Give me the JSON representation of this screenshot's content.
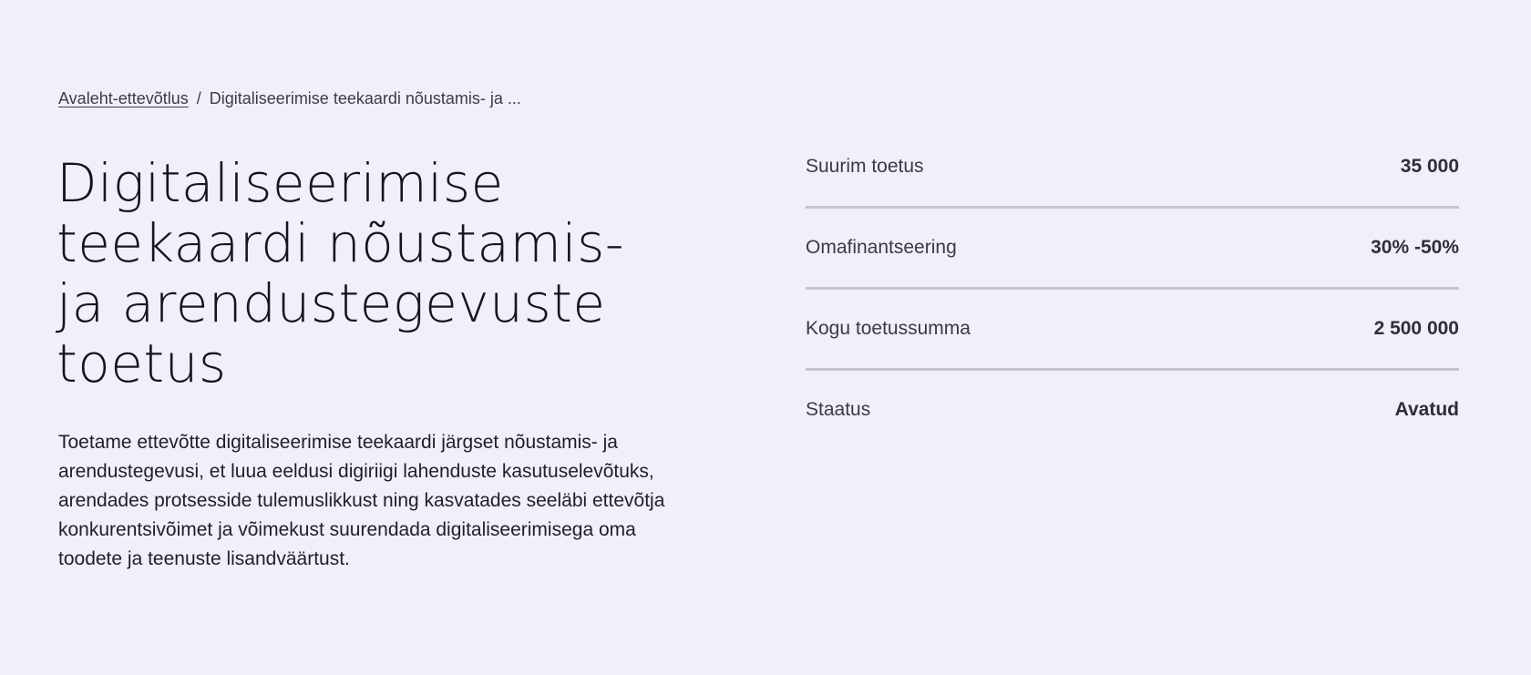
{
  "breadcrumb": {
    "home_label": "Avaleht-ettevõtlus",
    "separator": "/",
    "current_label": "Digitaliseerimise teekaardi nõustamis- ja ..."
  },
  "page": {
    "title": "Digitaliseerimise teekaardi nõustamis- ja arendustegevuste toetus",
    "description": "Toetame ettevõtte digitaliseerimise teekaardi järgset nõustamis- ja arendustegevusi, et luua eeldusi digiriigi lahenduste kasutuselevõtuks, arendades protsesside tulemuslikkust ning kasvatades seeläbi ettevõtja konkurentsivõimet ja võimekust suurendada digitaliseerimisega oma toodete ja teenuste lisandväärtust."
  },
  "facts": [
    {
      "label": "Suurim toetus",
      "value": "35 000"
    },
    {
      "label": "Omafinantseering",
      "value": "30% -50%"
    },
    {
      "label": "Kogu toetussumma",
      "value": "2 500 000"
    },
    {
      "label": "Staatus",
      "value": "Avatud"
    }
  ],
  "colors": {
    "background": "#f0f0fd",
    "text": "#1f1f29",
    "divider": "#c5c5cc"
  }
}
